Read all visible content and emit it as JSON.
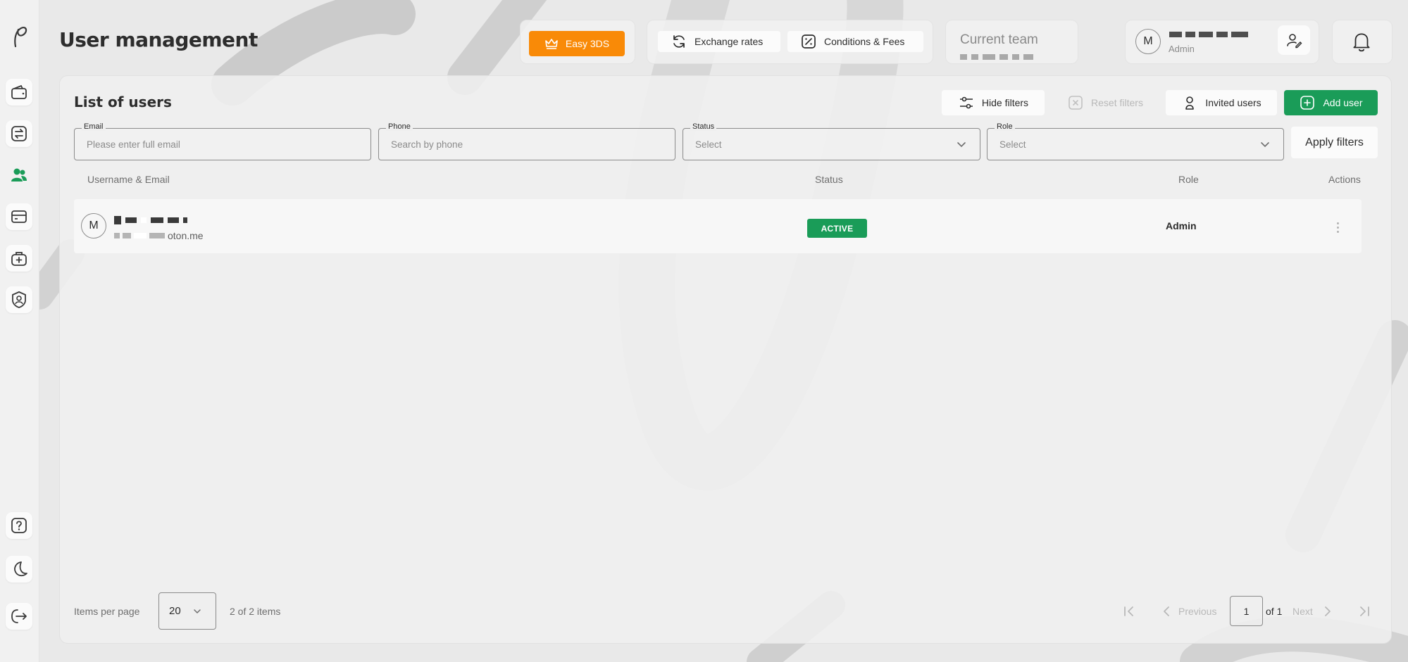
{
  "header": {
    "page_title": "User management",
    "easy_3ds": "Easy 3DS",
    "exchange_rates": "Exchange rates",
    "conditions_fees": "Conditions & Fees",
    "current_team_title": "Current team",
    "user_initial": "M",
    "user_role": "Admin"
  },
  "list": {
    "title": "List of users",
    "hide_filters": "Hide filters",
    "reset_filters": "Reset filters",
    "invited_users": "Invited users",
    "add_user": "Add user",
    "apply_filters": "Apply filters"
  },
  "filters": {
    "email": {
      "label": "Email",
      "placeholder": "Please enter full email"
    },
    "phone": {
      "label": "Phone",
      "placeholder": "Search by phone"
    },
    "status": {
      "label": "Status",
      "value": "Select"
    },
    "role": {
      "label": "Role",
      "value": "Select"
    }
  },
  "table": {
    "columns": [
      "Username & Email",
      "Status",
      "Role",
      "Actions"
    ],
    "rows": [
      {
        "initial": "M",
        "email_suffix": "oton.me",
        "status": "ACTIVE",
        "role": "Admin"
      }
    ]
  },
  "footer": {
    "items_per_page_label": "Items per page",
    "items_per_page": "20",
    "items_count": "2 of 2 items",
    "previous": "Previous",
    "next": "Next",
    "page": "1",
    "of_pages": "of 1"
  },
  "colors": {
    "accent_orange": "#f98a07",
    "accent_green": "#1a9c58"
  },
  "icons": {
    "sidebar": [
      "wallet-icon",
      "transfer-icon",
      "users-icon",
      "card-icon",
      "medical-bag-icon",
      "user-shield-icon",
      "help-icon",
      "moon-icon",
      "logout-icon"
    ],
    "header": [
      "crown-icon",
      "refresh-icon",
      "percent-icon",
      "user-edit-icon",
      "bell-icon"
    ]
  }
}
